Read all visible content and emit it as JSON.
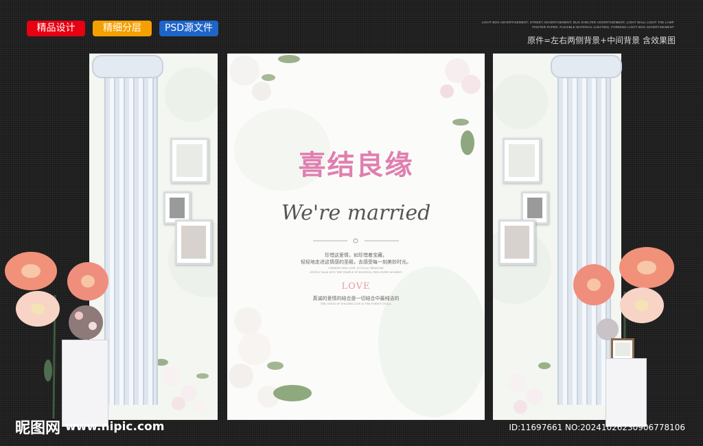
{
  "badges": [
    {
      "label": "精品设计",
      "color": "#e60012"
    },
    {
      "label": "精细分层",
      "color": "#f5a000"
    },
    {
      "label": "PSD源文件",
      "color": "#1f64c8"
    }
  ],
  "top_right": {
    "fine_lines": [
      "LIGHT BOX ADVERTISEMENT, STREET ADVERTISEMENT, BUS SHELTER ADVERTISEMENT, LIGHT WALL LIGHT THE LAMP",
      "POSTER PAPER, FLEXIBLE MATERIAL LIGHTING, FORMING LIGHT BOX ADVERTISEMENT"
    ],
    "note": "原件=左右两侧背景+中间背景 含效果图"
  },
  "center": {
    "title_cn": "喜结良缘",
    "title_en": "We're married",
    "body_1": "珍惜这爱情，如珍惜着宝藏，",
    "body_2": "轻轻地走进这情感的圣殿，去感受每一刻美妙时光。",
    "small_en_1": "CHERISH THIS LOVE, SUCH AS TREASURE",
    "small_en_2": "GENTLY WALK INTO THE TEMPLE OF EMOTION, FEEL EVERY MOMENT",
    "love": "LOVE",
    "tagline": "真诚的爱情的结合是一切结合中最纯洁的",
    "tagline_en": "THE UNION OF SINCERE LOVE IS THE PUREST OF ALL"
  },
  "watermark": {
    "logo": "昵图网",
    "url": "www.nipic.com"
  },
  "id_text": "ID:11697661 NO:20241026230906778106",
  "colors": {
    "pink_title": "#e07fb0",
    "background": "#1c1c1c",
    "panel": "#f3f6f1"
  }
}
